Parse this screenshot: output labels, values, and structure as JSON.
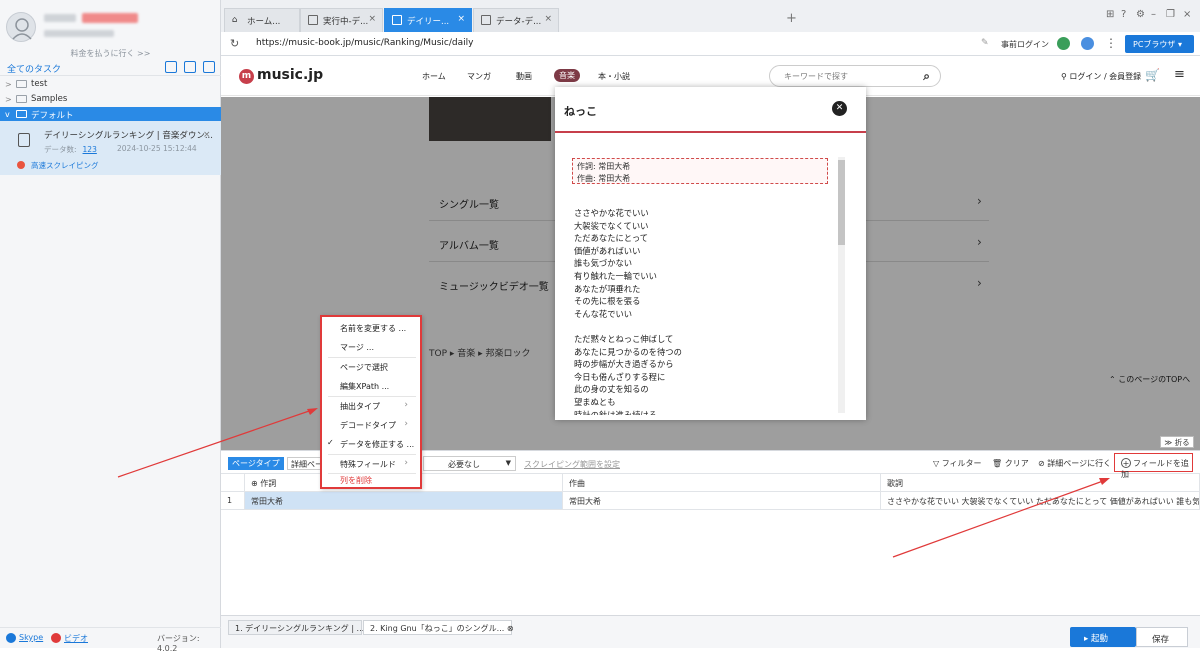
{
  "sidebar": {
    "pay_link": "料金を払うに行く >>",
    "tasks_title": "全てのタスク",
    "tree": [
      "test",
      "Samples",
      "デフォルト"
    ],
    "task": {
      "title": "デイリーシングルランキング | 音楽ダウン...",
      "count_label": "データ数:",
      "count": "123",
      "date": "2024-10-25 15:12:44",
      "mode": "高速スクレイピング"
    },
    "footer": {
      "skype": "Skype",
      "video": "ビデオ",
      "version": "バージョン: 4.0.2"
    }
  },
  "browser": {
    "tabs": [
      "ホーム...",
      "実行中-デ...",
      "デイリー...",
      "データ-デ..."
    ],
    "active_tab": 2,
    "url": "https://music-book.jp/music/Ranking/Music/daily",
    "prelogin": "事前ログイン",
    "pc_browser": "PCブラウザ"
  },
  "site": {
    "logo": "music.jp",
    "nav": [
      "ホーム",
      "マンガ",
      "動画",
      "音楽",
      "本・小説"
    ],
    "search_placeholder": "キーワードで探す",
    "login": "ログイン / 会員登録",
    "links": [
      "シングル一覧",
      "アルバム一覧",
      "ミュージックビデオ一覧"
    ],
    "breadcrumbs": [
      "TOP",
      "音楽",
      "邦楽ロック"
    ],
    "to_top": "このページのTOPへ"
  },
  "modal": {
    "title": "ねっこ",
    "lyricist": "作詞: 常田大希",
    "composer": "作曲: 常田大希",
    "lyrics": "ささやかな花でいい\n大袈裟でなくていい\nただあなたにとって\n価値があればいい\n誰も気づかない\n有り触れた一輪でいい\nあなたが項垂れた\nその先に根を張る\nそんな花でいい\n\nただ黙々とねっこ伸ばして\nあなたに見つかるのを待つの\n時の步幅が大き過ぎるから\n今日も倦んざりする程に\n此の身の丈を知るの\n望まぬとも\n時計の針は進み続ける"
  },
  "toolbar": {
    "page_type": "ページタイプ",
    "detail_page": "詳細ページ",
    "necessity": "必要なし",
    "scrape_range": "スクレイピング範囲を設定",
    "filter": "フィルター",
    "clear": "クリア",
    "goto_detail": "詳細ページに行く",
    "add_field": "フィールドを追加",
    "collapse": "折る"
  },
  "table": {
    "headers": [
      "作詞",
      "作曲",
      "歌詞"
    ],
    "rows": [
      {
        "index": "1",
        "lyricist": "常田大希",
        "composer": "常田大希",
        "lyrics": "ささやかな花でいい 大袈裟でなくていい ただあなたにとって 価値があればいい 誰も気づ..."
      }
    ]
  },
  "context_menu": {
    "items": [
      "名前を変更する ...",
      "マージ ...",
      "ページで選択",
      "編集XPath ...",
      "抽出タイプ",
      "デコードタイプ",
      "データを修正する ...",
      "特殊フィールド",
      "列を削除"
    ]
  },
  "bottom": {
    "tabs": [
      "1. デイリーシングルランキング | ...",
      "2. King Gnu「ねっこ」のシングル..."
    ],
    "start": "起動",
    "save": "保存"
  },
  "colors": {
    "accent": "#2a8ae6",
    "highlight": "#e03a3a",
    "brand": "#c73f4b"
  }
}
